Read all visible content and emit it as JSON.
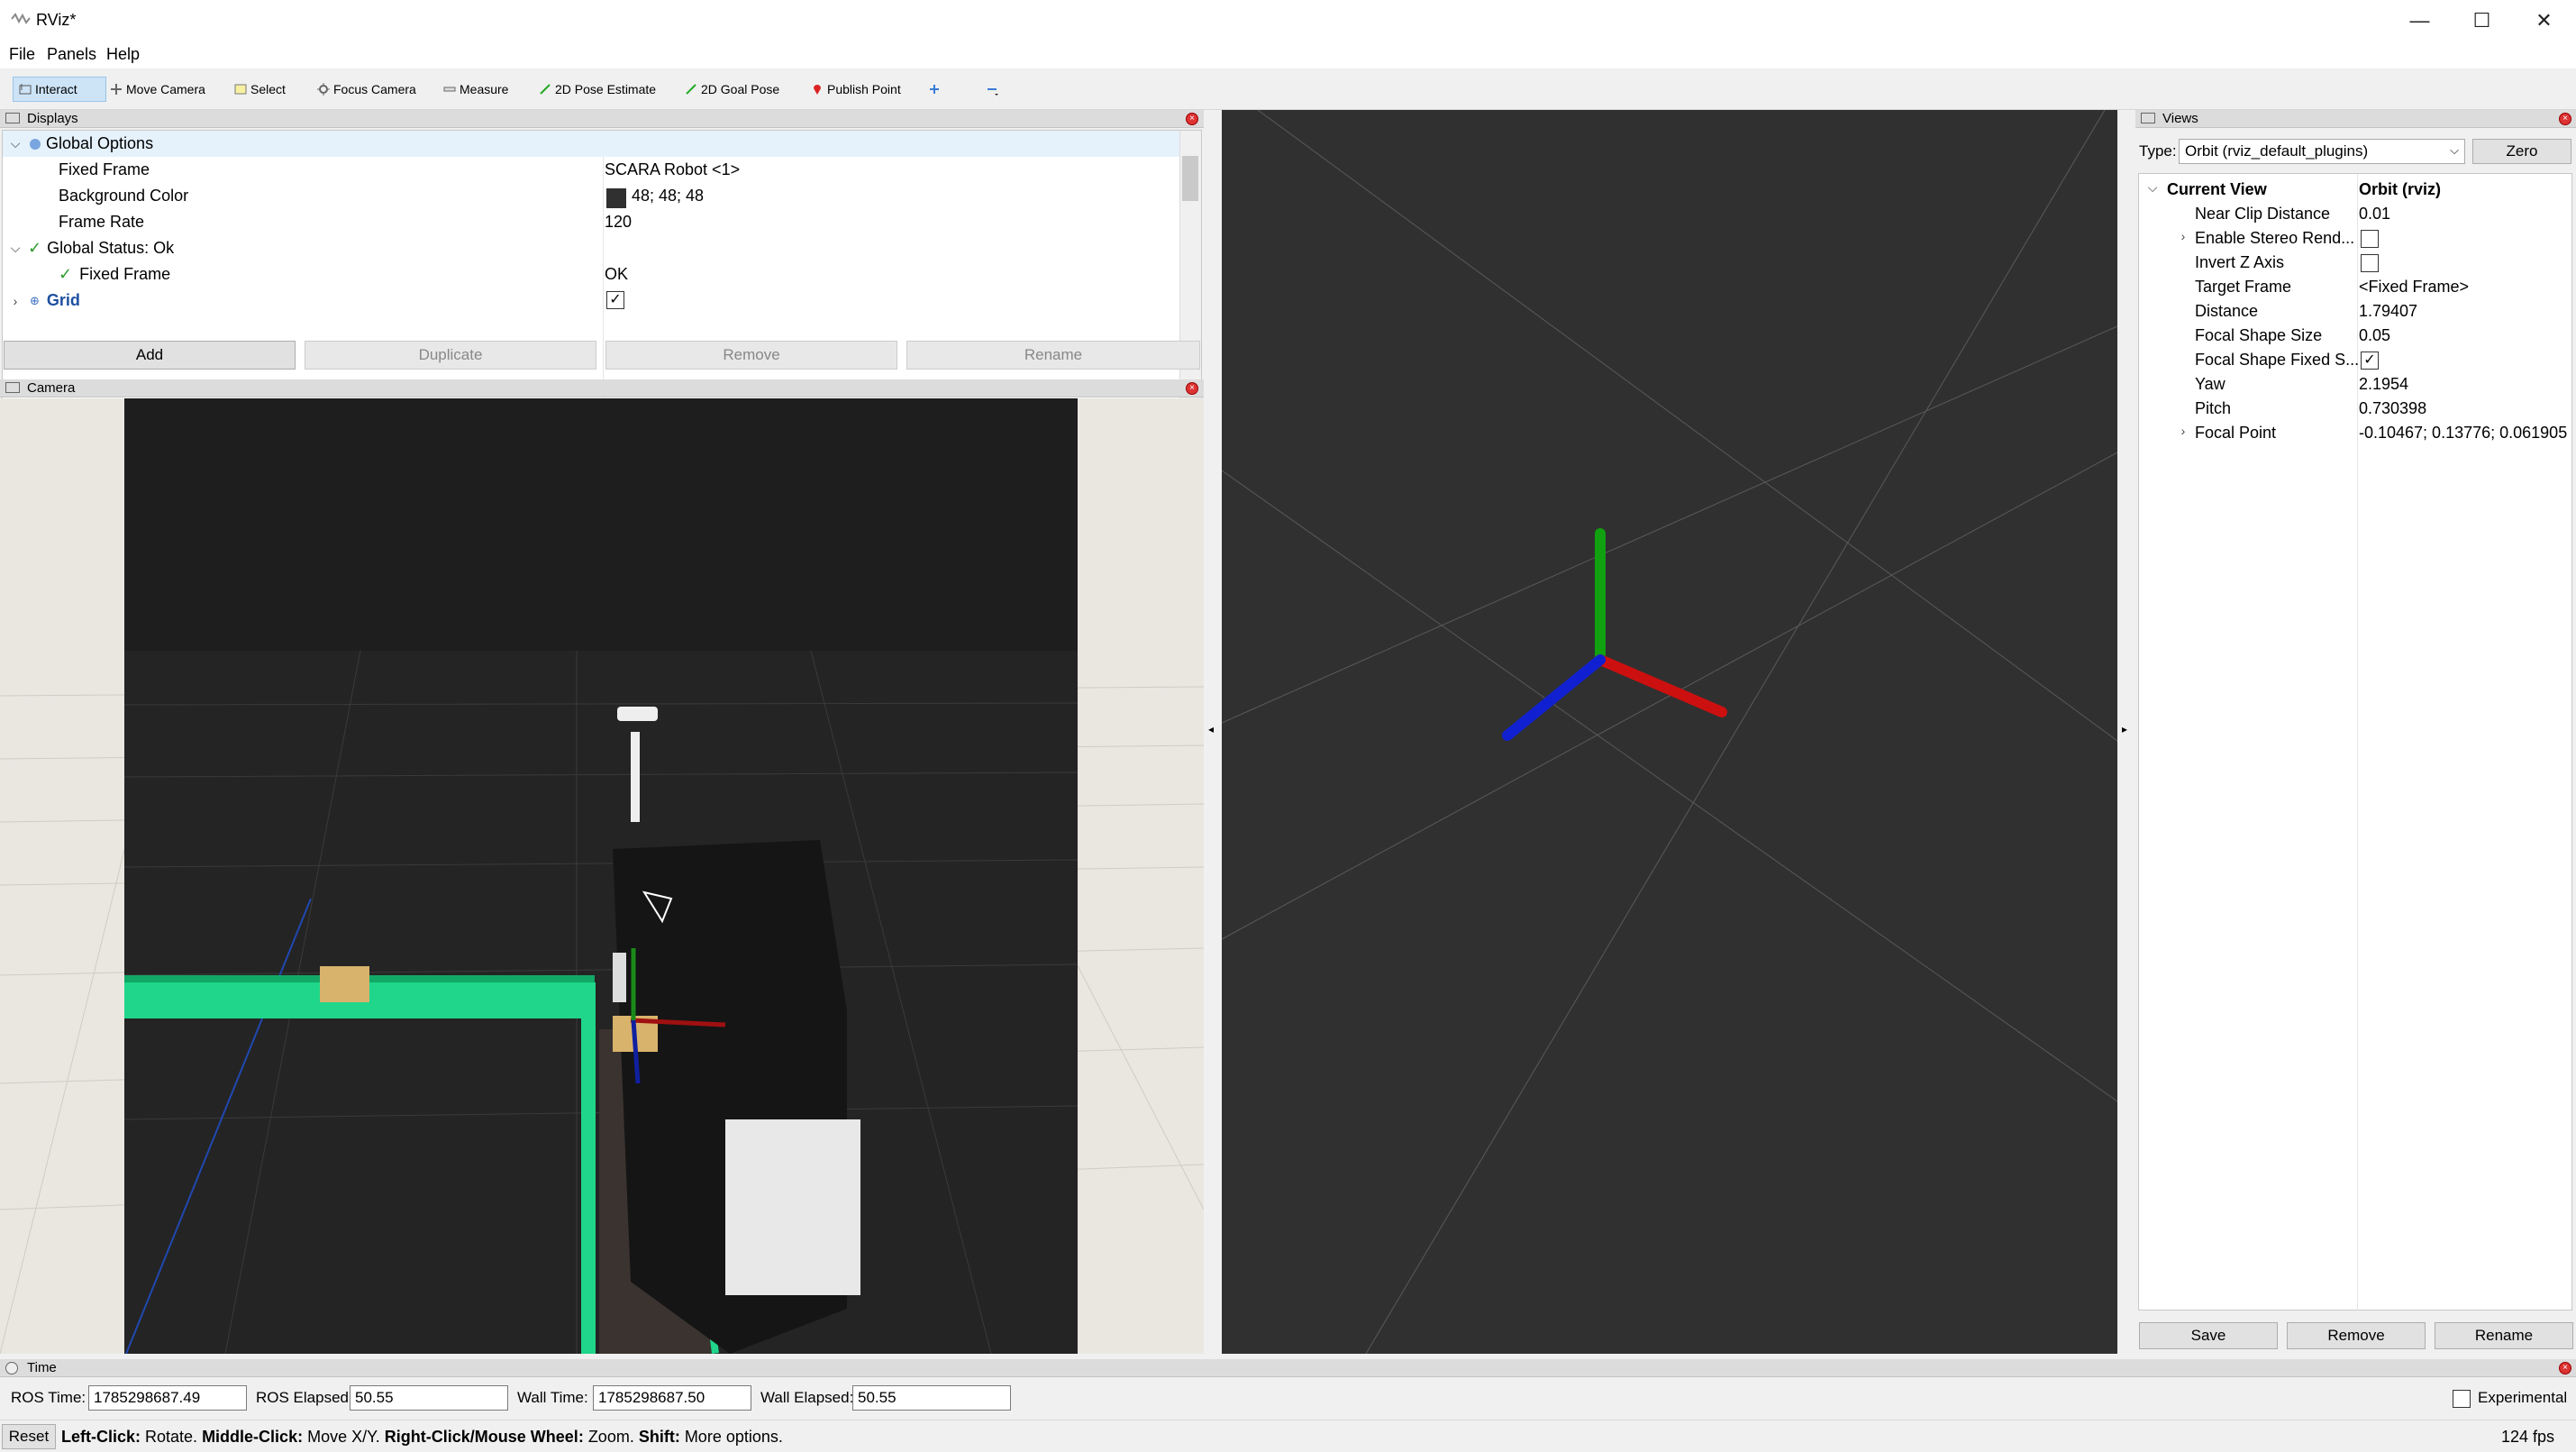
{
  "window": {
    "title": "RViz*"
  },
  "menu": [
    "File",
    "Panels",
    "Help"
  ],
  "toolbar": {
    "tools": [
      {
        "label": "Interact",
        "icon": "interact-icon",
        "active": true
      },
      {
        "label": "Move Camera",
        "icon": "move-camera-icon"
      },
      {
        "label": "Select",
        "icon": "select-icon"
      },
      {
        "label": "Focus Camera",
        "icon": "focus-camera-icon"
      },
      {
        "label": "Measure",
        "icon": "measure-icon"
      },
      {
        "label": "2D Pose Estimate",
        "icon": "pose-estimate-icon"
      },
      {
        "label": "2D Goal Pose",
        "icon": "goal-pose-icon"
      },
      {
        "label": "Publish Point",
        "icon": "publish-point-icon"
      }
    ]
  },
  "displays": {
    "title": "Displays",
    "rows": [
      {
        "label": "Global Options",
        "value": ""
      },
      {
        "label": "Fixed Frame",
        "value": "SCARA Robot <1>"
      },
      {
        "label": "Background Color",
        "value": "48; 48; 48"
      },
      {
        "label": "Frame Rate",
        "value": "120"
      },
      {
        "label": "Global Status: Ok",
        "value": ""
      },
      {
        "label": "Fixed Frame",
        "value": "OK"
      },
      {
        "label": "Grid",
        "value": ""
      }
    ],
    "buttons": [
      "Add",
      "Duplicate",
      "Remove",
      "Rename"
    ]
  },
  "camera": {
    "title": "Camera"
  },
  "views": {
    "title": "Views",
    "type_label": "Type:",
    "type_value": "Orbit (rviz_default_plugins)",
    "zero_label": "Zero",
    "current_view": {
      "label": "Current View",
      "value": "Orbit (rviz)"
    },
    "props": [
      {
        "label": "Near Clip Distance",
        "value": "0.01"
      },
      {
        "label": "Enable Stereo Rend...",
        "value": ""
      },
      {
        "label": "Invert Z Axis",
        "value": ""
      },
      {
        "label": "Target Frame",
        "value": "<Fixed Frame>"
      },
      {
        "label": "Distance",
        "value": "1.79407"
      },
      {
        "label": "Focal Shape Size",
        "value": "0.05"
      },
      {
        "label": "Focal Shape Fixed S...",
        "value": ""
      },
      {
        "label": "Yaw",
        "value": "2.1954"
      },
      {
        "label": "Pitch",
        "value": "0.730398"
      },
      {
        "label": "Focal Point",
        "value": "-0.10467; 0.13776; 0.061905"
      }
    ],
    "buttons": [
      "Save",
      "Remove",
      "Rename"
    ]
  },
  "time": {
    "title": "Time",
    "ros_time_label": "ROS Time:",
    "ros_time": "1785298687.49",
    "ros_elapsed_label": "ROS Elapsed:",
    "ros_elapsed": "50.55",
    "wall_time_label": "Wall Time:",
    "wall_time": "1785298687.50",
    "wall_elapsed_label": "Wall Elapsed:",
    "wall_elapsed": "50.55",
    "experimental_label": "Experimental"
  },
  "status": {
    "reset_label": "Reset",
    "hint_left": "Left-Click:",
    "hint_left_t": " Rotate. ",
    "hint_mid": "Middle-Click:",
    "hint_mid_t": " Move X/Y. ",
    "hint_right": "Right-Click/Mouse Wheel:",
    "hint_right_t": " Zoom. ",
    "hint_shift": "Shift:",
    "hint_shift_t": " More options.",
    "fps": "124 fps"
  },
  "colors": {
    "viewport_bg": "#303030",
    "accent": "#1d4fa0",
    "axis_x": "#cc1010",
    "axis_y": "#10a010",
    "axis_z": "#1020d0"
  }
}
